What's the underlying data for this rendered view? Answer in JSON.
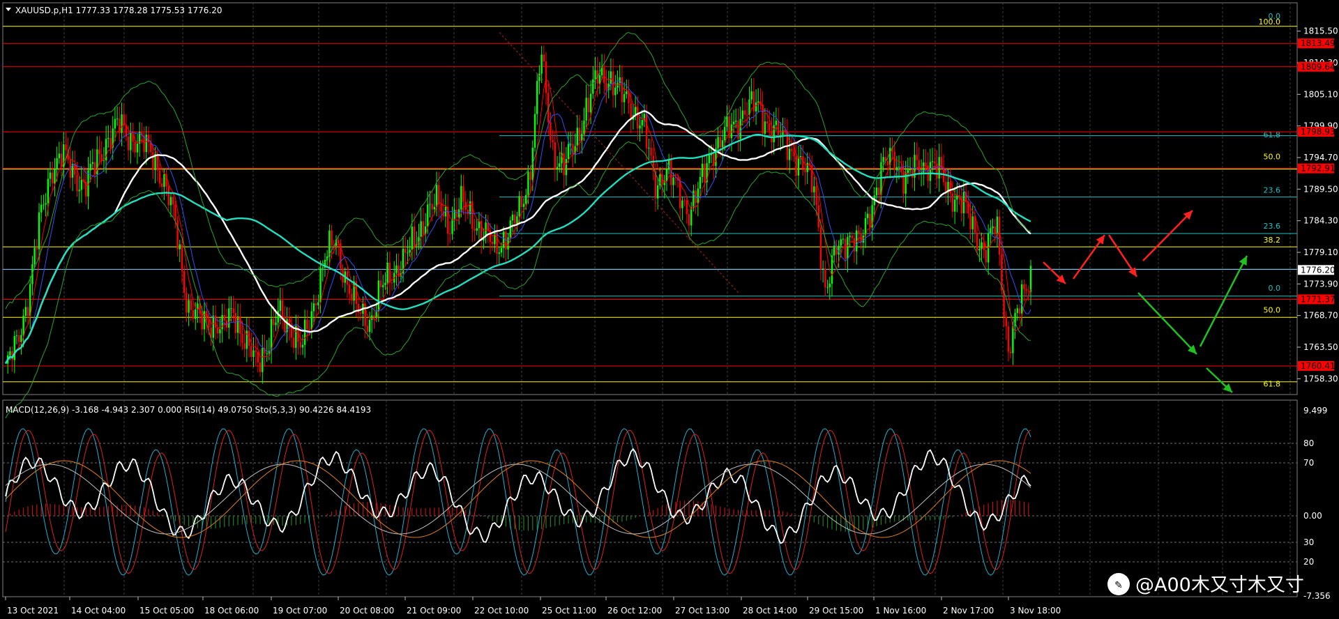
{
  "colors": {
    "bg": "#000000",
    "grid": "#404040",
    "axis_text": "#ffffff",
    "bull": "#00ff00",
    "bear": "#ff0000",
    "sma_white": "#ffffff",
    "sma_teal": "#20e0c0",
    "bollinger": "#2aa52a",
    "fib_yellow": "#ffff00",
    "fib_teal": "#20c0c0",
    "sr_red": "#ff0000",
    "arrow_red": "#ff2020",
    "arrow_green": "#20c020"
  },
  "header": {
    "symbol_line": "XAUUSD.p,H1  1777.33 1778.28 1775.53 1776.20"
  },
  "subheader": {
    "indicator_line": "MACD(12,26,9) -3.168 -4.943 2.307 0.000  RSI(14) 49.0750  Sto(5,3,3) 90.4226 84.4193"
  },
  "price_axis": {
    "ticks": [
      "1815.50",
      "1810.30",
      "1805.10",
      "1799.90",
      "1794.70",
      "1789.50",
      "1784.30",
      "1779.10",
      "1773.90",
      "1768.70",
      "1763.50",
      "1758.30"
    ],
    "current_price": "1776.20",
    "red_levels": [
      "1813.49",
      "1809.64",
      "1798.93",
      "1792.91",
      "1771.37",
      "1760.41"
    ]
  },
  "fib_labels": {
    "right_set": [
      "0.0",
      "100.0",
      "61.8",
      "50.0",
      "23.6",
      "38.2",
      "61.8",
      "50.0",
      "0.0",
      "23.6"
    ]
  },
  "indicator_axis": {
    "ticks": [
      "9.499",
      "80",
      "70",
      "0.00",
      "30",
      "20",
      "-7.356"
    ]
  },
  "time_axis": {
    "labels": [
      "13 Oct 2021",
      "14 Oct 04:00",
      "15 Oct 05:00",
      "18 Oct 06:00",
      "19 Oct 07:00",
      "20 Oct 08:00",
      "21 Oct 09:00",
      "22 Oct 10:00",
      "25 Oct 11:00",
      "26 Oct 12:00",
      "27 Oct 13:00",
      "28 Oct 14:00",
      "29 Oct 15:00",
      "1 Nov 16:00",
      "2 Nov 17:00",
      "3 Nov 18:00"
    ]
  },
  "watermark": {
    "text": "@A00木又寸木又寸"
  },
  "chart_data": {
    "type": "candlestick",
    "symbol": "XAUUSD.p",
    "timeframe": "H1",
    "last": {
      "open": 1777.33,
      "high": 1778.28,
      "low": 1775.53,
      "close": 1776.2
    },
    "ylim": [
      1755.7,
      1818.1
    ],
    "horizontal_levels": [
      1813.49,
      1809.64,
      1798.93,
      1792.91,
      1771.37,
      1760.41
    ],
    "close_path": [
      1760,
      1764,
      1772,
      1784,
      1793,
      1795,
      1792,
      1790,
      1794,
      1798,
      1800,
      1798,
      1797,
      1795,
      1790,
      1783,
      1770,
      1768,
      1768,
      1766,
      1770,
      1764,
      1761,
      1764,
      1769,
      1767,
      1763,
      1770,
      1778,
      1781,
      1774,
      1769,
      1768,
      1773,
      1776,
      1778,
      1781,
      1786,
      1787,
      1784,
      1787,
      1785,
      1782,
      1780,
      1782,
      1785,
      1792,
      1812,
      1796,
      1793,
      1797,
      1803,
      1808,
      1808,
      1805,
      1803,
      1800,
      1790,
      1793,
      1789,
      1786,
      1790,
      1796,
      1798,
      1800,
      1803,
      1803,
      1800,
      1798,
      1796,
      1793,
      1790,
      1772,
      1780,
      1782,
      1780,
      1787,
      1793,
      1795,
      1791,
      1793,
      1794,
      1792,
      1789,
      1787,
      1783,
      1779,
      1784,
      1763,
      1770,
      1776
    ]
  }
}
